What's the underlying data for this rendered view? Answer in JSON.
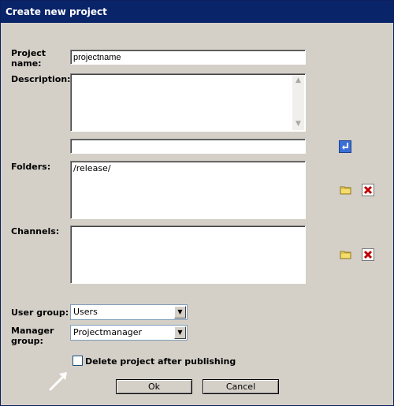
{
  "window": {
    "title": "Create new project"
  },
  "form": {
    "project_name": {
      "label": "Project name:",
      "value": "projectname"
    },
    "description": {
      "label": "Description:",
      "value": ""
    },
    "folder_path": {
      "value": ""
    },
    "folders": {
      "label": "Folders:",
      "items": [
        "/release/"
      ]
    },
    "channels": {
      "label": "Channels:",
      "items": []
    },
    "user_group": {
      "label": "User group:",
      "selected": "Users"
    },
    "manager_group": {
      "label": "Manager group:",
      "selected": "Projectmanager"
    },
    "delete_after_publish": {
      "label": "Delete project after publishing",
      "checked": false
    }
  },
  "buttons": {
    "ok": "Ok",
    "cancel": "Cancel"
  },
  "icons": {
    "apply": "enter-arrow-icon",
    "browse": "folder-icon",
    "remove": "red-x-delete-icon",
    "pointer": "white-arrow-icon"
  }
}
